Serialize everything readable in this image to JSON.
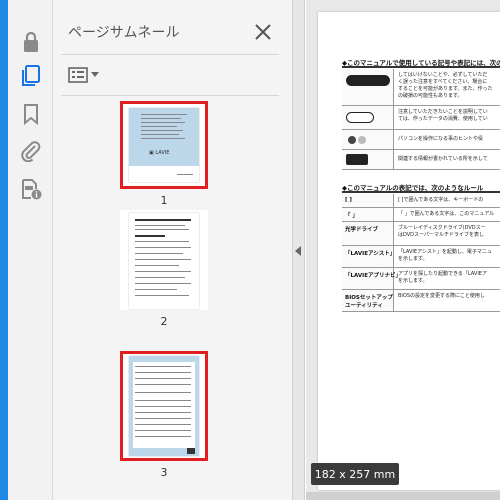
{
  "panel": {
    "title": "ページサムネール"
  },
  "thumbnails": [
    {
      "number": "1",
      "selected": true
    },
    {
      "number": "2",
      "selected": false
    },
    {
      "number": "3",
      "selected": true
    }
  ],
  "document": {
    "heading1": "◆このマニュアルで使用している記号や表記には、次の",
    "rows1": [
      {
        "text1": "してはいけないことや、必ずしていただ",
        "text2": "く誤った注意をすべてください。場合に",
        "text3": "することを可能があります。また、作った",
        "text4": "の破損の可能性もあります。"
      },
      {
        "text1": "注意していただきたいことを説明してい",
        "text2": "ては、作ったデータの消費、使用してい"
      },
      {
        "text1": "パソコンを操作になる事のヒントや役"
      },
      {
        "text1": "関連する情報が書かれている所を示して"
      }
    ],
    "heading2": "◆このマニュアルの表記では、次のようなルール",
    "rows2": [
      {
        "label": "[  ]",
        "text1": "[  ]で囲んである文字は、キーボードの"
      },
      {
        "label": "「  」",
        "text1": "「  」で囲んである文字は、このマニュアル"
      },
      {
        "label": "光学ドライブ",
        "text1": "ブルーレイディスクドライブ(DVDスー",
        "text2": "はDVDスーパーマルチドライブを表し"
      },
      {
        "label": "「LAVIEアシスト」",
        "text1": "「LAVIEアシスト」を起動し、電子マニュ",
        "text2": "を示します。"
      },
      {
        "label": "「LAVIEアプリナビ」",
        "text1": "アプリを探したり起動できる「LAVIEア",
        "text2": "を示します。"
      },
      {
        "label": "BIOSセットアップ",
        "label2": "ユーティリティ",
        "text1": "BIOSの設定を変更する際にこと使用し"
      }
    ]
  },
  "tooltip": {
    "text": "182 x 257 mm"
  }
}
